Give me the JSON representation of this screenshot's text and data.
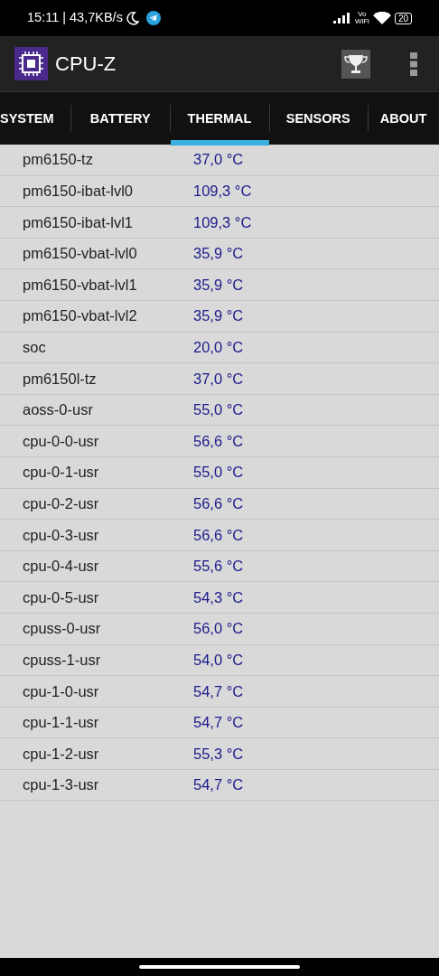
{
  "status_bar": {
    "time": "15:11 | 43,7KB/s",
    "vowifi_top": "Vo",
    "vowifi_bottom": "WiFi",
    "battery": "20"
  },
  "app_bar": {
    "title": "CPU-Z"
  },
  "tabs": [
    {
      "label": "SYSTEM",
      "selected": false
    },
    {
      "label": "BATTERY",
      "selected": false
    },
    {
      "label": "THERMAL",
      "selected": true
    },
    {
      "label": "SENSORS",
      "selected": false
    },
    {
      "label": "ABOUT",
      "selected": false
    }
  ],
  "sensors": [
    {
      "name": "pm6150-tz",
      "value": "37,0 °C"
    },
    {
      "name": "pm6150-ibat-lvl0",
      "value": "109,3 °C"
    },
    {
      "name": "pm6150-ibat-lvl1",
      "value": "109,3 °C"
    },
    {
      "name": "pm6150-vbat-lvl0",
      "value": "35,9 °C"
    },
    {
      "name": "pm6150-vbat-lvl1",
      "value": "35,9 °C"
    },
    {
      "name": "pm6150-vbat-lvl2",
      "value": "35,9 °C"
    },
    {
      "name": "soc",
      "value": "20,0 °C"
    },
    {
      "name": "pm6150l-tz",
      "value": "37,0 °C"
    },
    {
      "name": "aoss-0-usr",
      "value": "55,0 °C"
    },
    {
      "name": "cpu-0-0-usr",
      "value": "56,6 °C"
    },
    {
      "name": "cpu-0-1-usr",
      "value": "55,0 °C"
    },
    {
      "name": "cpu-0-2-usr",
      "value": "56,6 °C"
    },
    {
      "name": "cpu-0-3-usr",
      "value": "56,6 °C"
    },
    {
      "name": "cpu-0-4-usr",
      "value": "55,6 °C"
    },
    {
      "name": "cpu-0-5-usr",
      "value": "54,3 °C"
    },
    {
      "name": "cpuss-0-usr",
      "value": "56,0 °C"
    },
    {
      "name": "cpuss-1-usr",
      "value": "54,0 °C"
    },
    {
      "name": "cpu-1-0-usr",
      "value": "54,7 °C"
    },
    {
      "name": "cpu-1-1-usr",
      "value": "54,7 °C"
    },
    {
      "name": "cpu-1-2-usr",
      "value": "55,3 °C"
    },
    {
      "name": "cpu-1-3-usr",
      "value": "54,7 °C"
    }
  ]
}
